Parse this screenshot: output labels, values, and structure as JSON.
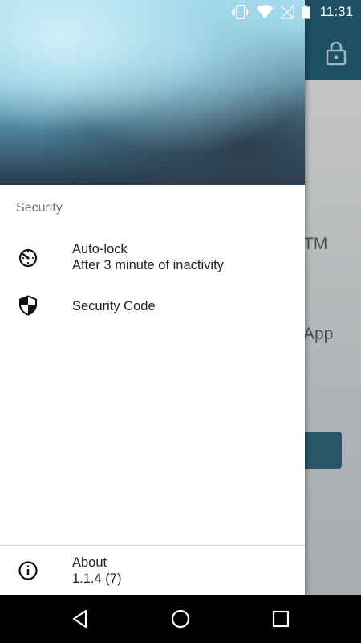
{
  "status_bar": {
    "time": "11:31",
    "icons": [
      "vibrate-icon",
      "wifi-icon",
      "no-signal-icon",
      "battery-icon"
    ]
  },
  "background_app": {
    "toolbar_color": "#1e4f63",
    "partial_text_1": "TM",
    "partial_text_2": "App"
  },
  "drawer": {
    "section_title": "Security",
    "items": [
      {
        "icon": "timer-icon",
        "title": "Auto-lock",
        "subtitle": "After 3 minute of inactivity"
      },
      {
        "icon": "shield-icon",
        "title": "Security Code"
      }
    ],
    "footer": {
      "icon": "info-icon",
      "title": "About",
      "subtitle": "1.1.4 (7)"
    }
  },
  "nav_bar": {
    "buttons": [
      "back-icon",
      "home-icon",
      "recents-icon"
    ]
  }
}
